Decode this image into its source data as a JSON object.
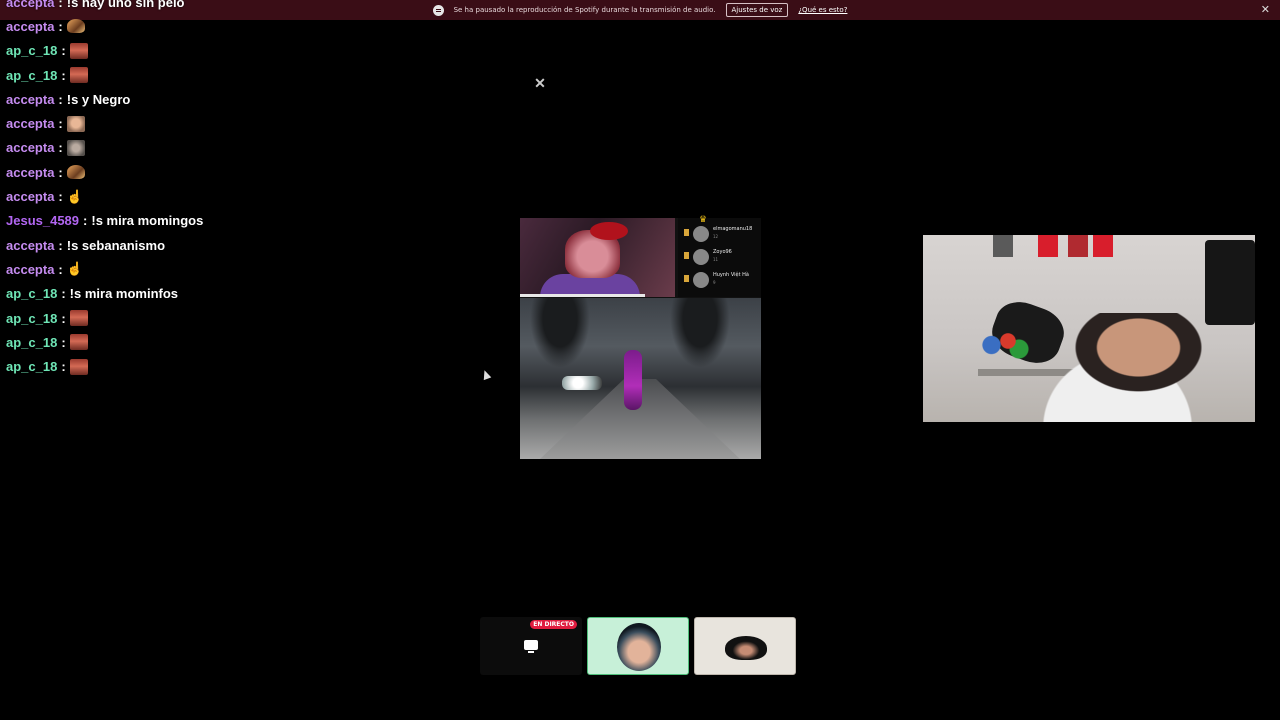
{
  "notification": {
    "message": "Se ha pausado la reproducción de Spotify durante la transmisión de audio.",
    "settings_button": "Ajustes de voz",
    "info_link": "¿Qué es esto?",
    "close": "✕"
  },
  "chat": {
    "separator": ":",
    "messages": [
      {
        "user": "accepta",
        "color": "#c58cf0",
        "text": "!s hay uno sin pelo",
        "emote": null
      },
      {
        "user": "accepta",
        "color": "#c58cf0",
        "text": "",
        "emote": "tortilla"
      },
      {
        "user": "ap_c_18",
        "color": "#6fe6b6",
        "text": "",
        "emote": "face"
      },
      {
        "user": "ap_c_18",
        "color": "#6fe6b6",
        "text": "",
        "emote": "face"
      },
      {
        "user": "accepta",
        "color": "#c58cf0",
        "text": "!s y Negro",
        "emote": null
      },
      {
        "user": "accepta",
        "color": "#c58cf0",
        "text": "",
        "emote": "meme"
      },
      {
        "user": "accepta",
        "color": "#c58cf0",
        "text": "",
        "emote": "cat"
      },
      {
        "user": "accepta",
        "color": "#c58cf0",
        "text": "",
        "emote": "tortilla"
      },
      {
        "user": "accepta",
        "color": "#c58cf0",
        "text": "",
        "emote": "hand"
      },
      {
        "user": "Jesus_4589",
        "color": "#b266f2",
        "text": "!s mira momingos",
        "emote": null
      },
      {
        "user": "accepta",
        "color": "#c58cf0",
        "text": "!s sebananismo",
        "emote": null
      },
      {
        "user": "accepta",
        "color": "#c58cf0",
        "text": "",
        "emote": "hand"
      },
      {
        "user": "ap_c_18",
        "color": "#6fe6b6",
        "text": "!s mira mominfos",
        "emote": null
      },
      {
        "user": "ap_c_18",
        "color": "#6fe6b6",
        "text": "",
        "emote": "face"
      },
      {
        "user": "ap_c_18",
        "color": "#6fe6b6",
        "text": "",
        "emote": "face"
      },
      {
        "user": "ap_c_18",
        "color": "#6fe6b6",
        "text": "",
        "emote": "face"
      }
    ]
  },
  "leaderboard": [
    {
      "name": "elmagomanu18",
      "sub": "12"
    },
    {
      "name": "Zoyo96",
      "sub": "11"
    },
    {
      "name": "Huynh Việt Hà",
      "sub": "9"
    }
  ],
  "tiles": {
    "live_badge": "EN DIRECTO"
  }
}
